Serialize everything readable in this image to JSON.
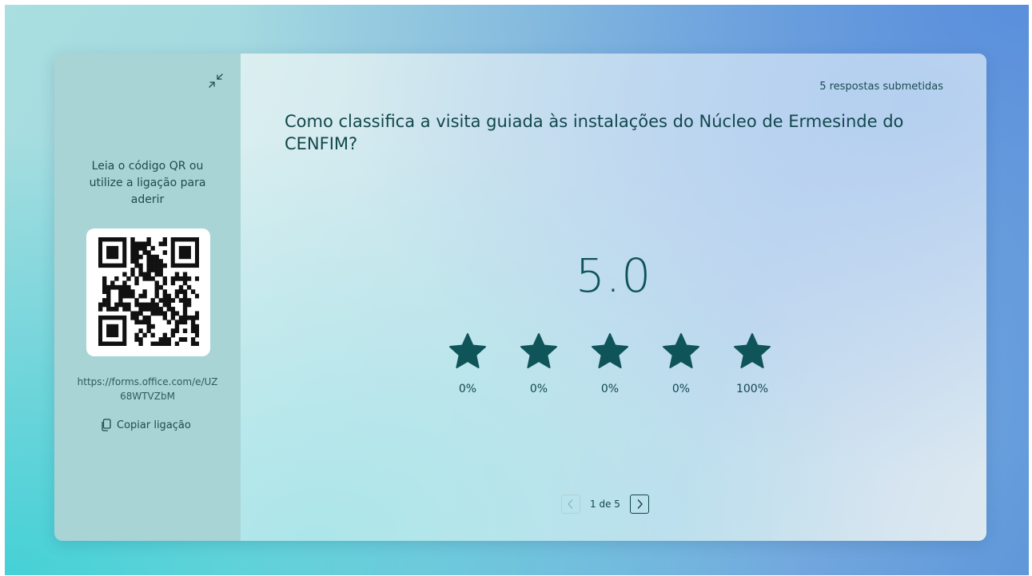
{
  "sidebar": {
    "join_instructions": "Leia o código QR ou utilize a ligação para aderir",
    "link": "https://forms.office.com/e/UZ68WTVZbM",
    "copy_label": "Copiar ligação"
  },
  "main": {
    "response_count": "5 respostas submetidas",
    "question": "Como classifica a visita guiada às instalações do Núcleo de Ermesinde do CENFIM?",
    "average": "5.0",
    "ratings": [
      {
        "stars": 1,
        "percent": "0%"
      },
      {
        "stars": 2,
        "percent": "0%"
      },
      {
        "stars": 3,
        "percent": "0%"
      },
      {
        "stars": 4,
        "percent": "0%"
      },
      {
        "stars": 5,
        "percent": "100%"
      }
    ],
    "pager": {
      "label": "1 de 5"
    }
  },
  "colors": {
    "accent": "#0e5459",
    "sidebar_bg": "#a9d4d5"
  },
  "icons": {
    "collapse": "collapse-icon",
    "copy": "copy-icon",
    "star": "star-icon",
    "prev": "chevron-left-icon",
    "next": "chevron-right-icon"
  }
}
